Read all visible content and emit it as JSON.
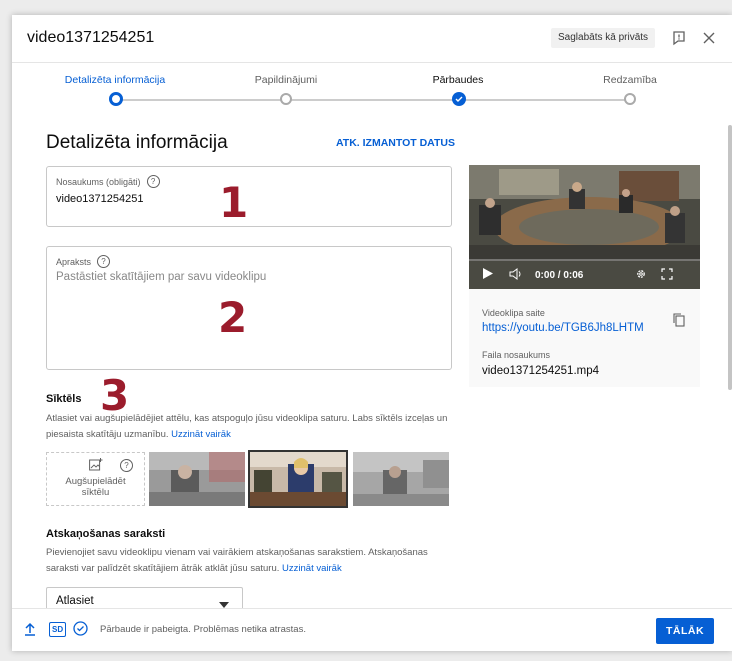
{
  "header": {
    "title": "video1371254251",
    "saved_chip": "Saglabāts kā privāts"
  },
  "steps": [
    {
      "label": "Detalizēta informācija",
      "state": "current"
    },
    {
      "label": "Papildinājumi",
      "state": "pending"
    },
    {
      "label": "Pārbaudes",
      "state": "done"
    },
    {
      "label": "Redzamība",
      "state": "pending"
    }
  ],
  "details": {
    "title": "Detalizēta informācija",
    "reuse_link": "ATK. IZMANTOT DATUS"
  },
  "title_field": {
    "label": "Nosaukums (obligāti)",
    "value": "video1371254251"
  },
  "description_field": {
    "label": "Apraksts",
    "placeholder": "Pastāstiet skatītājiem par savu videoklipu"
  },
  "annotations": [
    "1",
    "2",
    "3"
  ],
  "thumbnail": {
    "heading": "Sīktēls",
    "text": "Atlasiet vai augšupielādējiet attēlu, kas atspoguļo jūsu videoklipa saturu. Labs sīktēls izceļas un piesaista skatītāju uzmanību.",
    "learn_more": "Uzzināt vairāk",
    "upload_label": "Augšupielādēt sīktēlu"
  },
  "playlists": {
    "heading": "Atskaņošanas saraksti",
    "text": "Pievienojiet savu videoklipu vienam vai vairākiem atskaņošanas sarakstiem. Atskaņošanas saraksti var palīdzēt skatītājiem ātrāk atklāt jūsu saturu.",
    "learn_more": "Uzzināt vairāk",
    "select_value": "Atlasiet"
  },
  "preview": {
    "time": "0:00 / 0:06",
    "link_label": "Videoklipa saite",
    "link": "https://youtu.be/TGB6Jh8LHTM",
    "file_label": "Faila nosaukums",
    "file_name": "video1371254251.mp4"
  },
  "footer": {
    "sd_badge": "SD",
    "status": "Pārbaude ir pabeigta. Problēmas netika atrastas.",
    "next_label": "TĀLĀK"
  },
  "colors": {
    "accent": "#065fd4",
    "annotation": "#9b1c2c"
  }
}
